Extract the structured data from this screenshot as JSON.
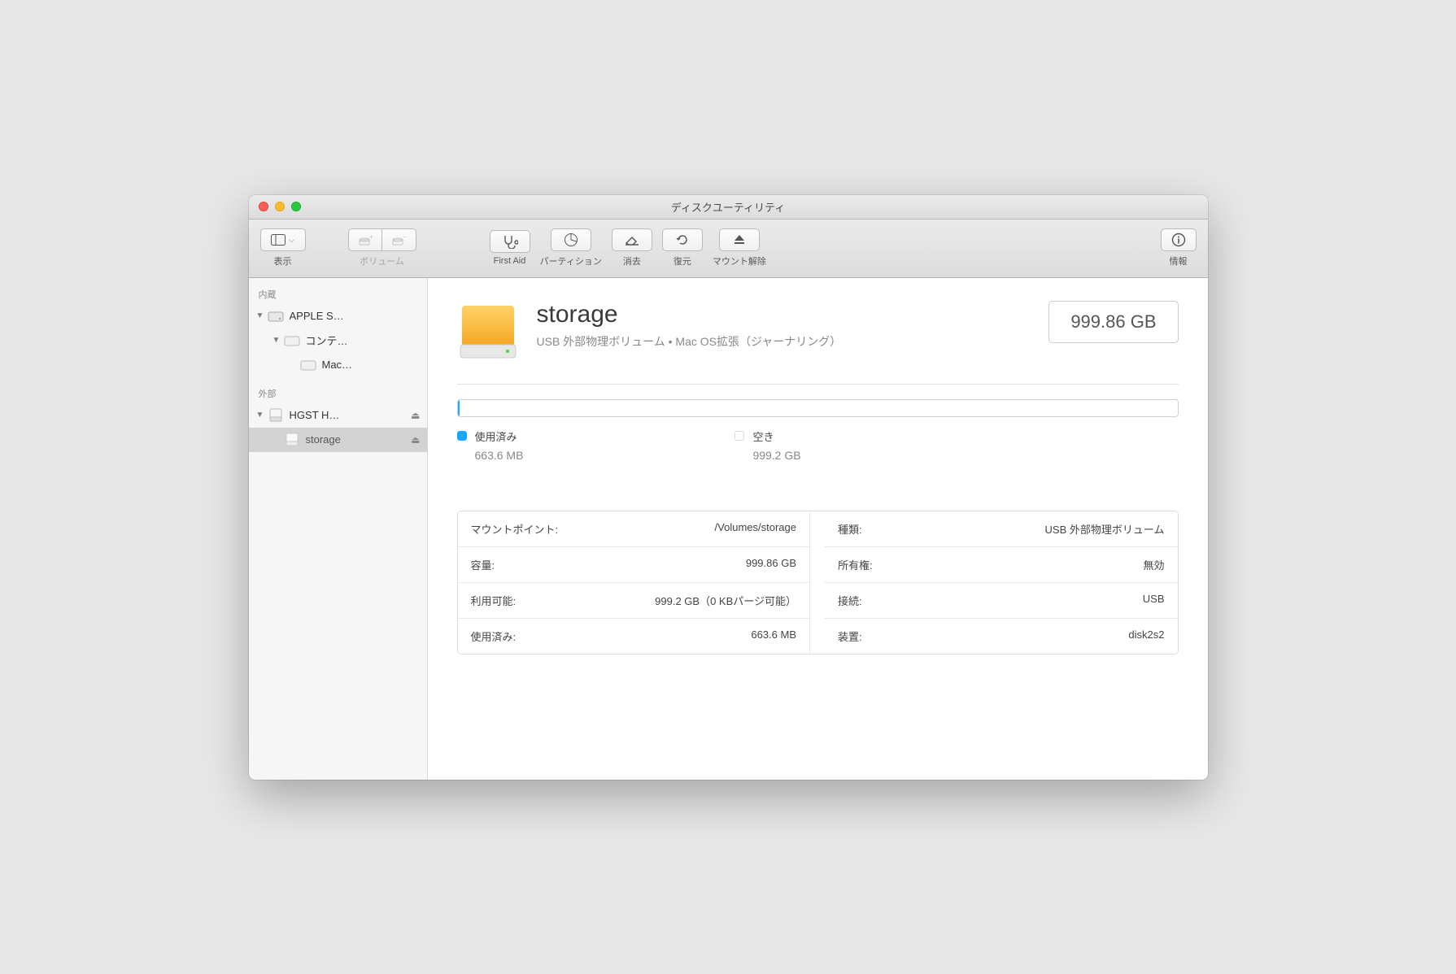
{
  "window": {
    "title": "ディスクユーティリティ"
  },
  "toolbar": {
    "view": "表示",
    "volume": "ボリューム",
    "first_aid": "First Aid",
    "partition": "パーティション",
    "erase": "消去",
    "restore": "復元",
    "unmount": "マウント解除",
    "info": "情報"
  },
  "sidebar": {
    "internal": "内蔵",
    "external": "外部",
    "items": [
      {
        "label": "APPLE S…",
        "indent": 0,
        "disclosure": true,
        "kind": "hdd"
      },
      {
        "label": "コンテ…",
        "indent": 1,
        "disclosure": true,
        "kind": "hdd"
      },
      {
        "label": "Mac…",
        "indent": 2,
        "disclosure": false,
        "kind": "hdd"
      },
      {
        "label": "HGST H…",
        "indent": 0,
        "disclosure": true,
        "eject": true,
        "kind": "ext"
      },
      {
        "label": "storage",
        "indent": 1,
        "disclosure": false,
        "eject": true,
        "selected": true,
        "kind": "ext"
      }
    ]
  },
  "volume": {
    "name": "storage",
    "subtitle": "USB 外部物理ボリューム • Mac OS拡張（ジャーナリング）",
    "capacity_badge": "999.86 GB",
    "usage": {
      "used_label": "使用済み",
      "used_value": "663.6 MB",
      "free_label": "空き",
      "free_value": "999.2 GB",
      "used_color": "#1aa9ff",
      "free_color": "#ffffff"
    },
    "details_left": [
      {
        "key": "マウントポイント:",
        "val": "/Volumes/storage"
      },
      {
        "key": "容量:",
        "val": "999.86 GB"
      },
      {
        "key": "利用可能:",
        "val": "999.2 GB（0 KBパージ可能）"
      },
      {
        "key": "使用済み:",
        "val": "663.6 MB"
      }
    ],
    "details_right": [
      {
        "key": "種類:",
        "val": "USB 外部物理ボリューム"
      },
      {
        "key": "所有権:",
        "val": "無効"
      },
      {
        "key": "接続:",
        "val": "USB"
      },
      {
        "key": "装置:",
        "val": "disk2s2"
      }
    ]
  }
}
